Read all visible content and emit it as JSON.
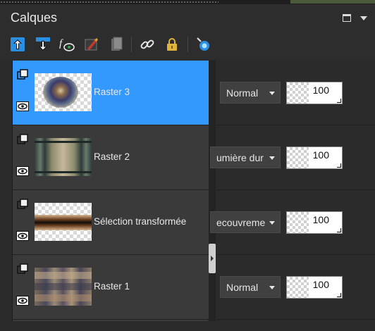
{
  "panel": {
    "title": "Calques",
    "title_buttons": [
      "maximize-icon",
      "panel-menu-icon"
    ]
  },
  "toolbar": {
    "icons": [
      "new-raster-layer-icon",
      "merge-down-icon",
      "layer-effects-icon",
      "brush-layer-icon",
      "delete-layer-icon",
      "link-layers-icon",
      "lock-layer-icon",
      "mask-layer-icon"
    ]
  },
  "layers": [
    {
      "name": "Raster 3",
      "selected": true,
      "blend_mode": "Normal",
      "opacity": "100"
    },
    {
      "name": "Raster 2",
      "selected": false,
      "blend_mode": "umière dur",
      "opacity": "100"
    },
    {
      "name": "Sélection transformée",
      "selected": false,
      "blend_mode": "ecouvreme",
      "opacity": "100"
    },
    {
      "name": "Raster 1",
      "selected": false,
      "blend_mode": "Normal",
      "opacity": "100"
    }
  ],
  "colors": {
    "selected_row": "#3399ff",
    "panel_bg": "#2b2b2b",
    "row_bg": "#3a3a3a"
  }
}
